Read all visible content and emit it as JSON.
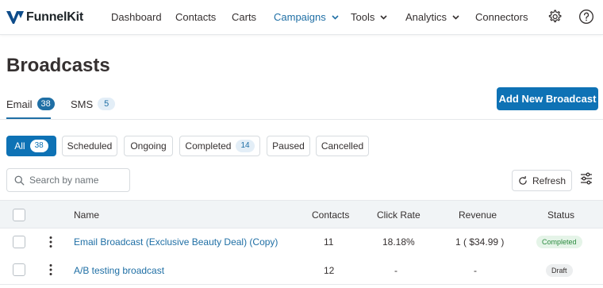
{
  "brand": {
    "name": "FunnelKit",
    "accent": "#0e72b5"
  },
  "nav": {
    "items": [
      {
        "label": "Dashboard"
      },
      {
        "label": "Contacts"
      },
      {
        "label": "Carts"
      },
      {
        "label": "Campaigns",
        "active": true,
        "dropdown": true
      },
      {
        "label": "Tools",
        "dropdown": true
      },
      {
        "label": "Analytics",
        "dropdown": true
      },
      {
        "label": "Connectors"
      }
    ],
    "icons": [
      "gear-icon",
      "help-icon"
    ]
  },
  "page": {
    "title": "Broadcasts"
  },
  "tabs": [
    {
      "label": "Email",
      "count": "38",
      "active": true
    },
    {
      "label": "SMS",
      "count": "5"
    }
  ],
  "actions": {
    "add_new": "Add New Broadcast",
    "refresh": "Refresh"
  },
  "filters": [
    {
      "label": "All",
      "count": "38",
      "active": true
    },
    {
      "label": "Scheduled"
    },
    {
      "label": "Ongoing"
    },
    {
      "label": "Completed",
      "count": "14"
    },
    {
      "label": "Paused"
    },
    {
      "label": "Cancelled"
    }
  ],
  "search": {
    "placeholder": "Search by name",
    "value": ""
  },
  "table": {
    "columns": [
      "Name",
      "Contacts",
      "Click Rate",
      "Revenue",
      "Status"
    ],
    "rows": [
      {
        "name": "Email Broadcast (Exclusive Beauty Deal) (Copy)",
        "contacts": "11",
        "click_rate": "18.18%",
        "revenue": "1 ( $34.99 )",
        "status": "Completed"
      },
      {
        "name": "A/B testing broadcast",
        "contacts": "12",
        "click_rate": "-",
        "revenue": "-",
        "status": "Draft"
      }
    ]
  }
}
